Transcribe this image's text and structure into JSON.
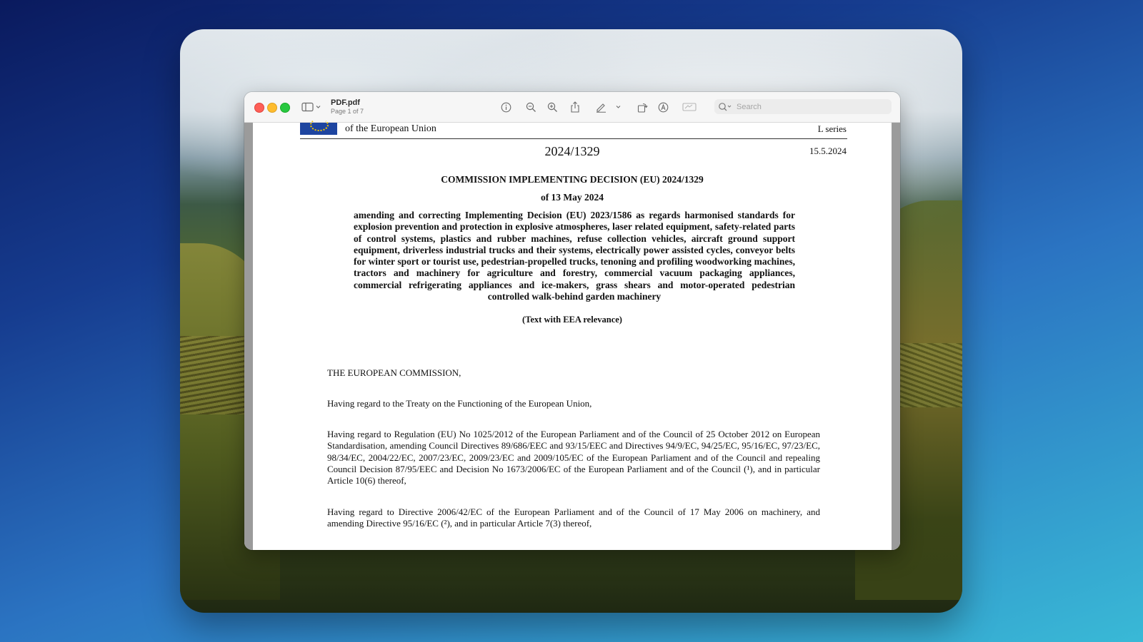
{
  "window": {
    "file_name": "PDF.pdf",
    "page_info": "Page 1 of 7"
  },
  "toolbar": {
    "icons": [
      "sidebar-icon",
      "chevron-down-icon",
      "info-icon",
      "zoom-out-icon",
      "zoom-in-icon",
      "share-icon",
      "markup-pen-icon",
      "chevron-down-icon",
      "rotate-icon",
      "annotate-icon",
      "form-icon",
      "search-icon"
    ]
  },
  "search": {
    "placeholder": "Search",
    "value": ""
  },
  "document": {
    "header": {
      "journal": "of the European Union",
      "series": "L series",
      "number": "2024/1329",
      "date": "15.5.2024"
    },
    "title": "COMMISSION IMPLEMENTING DECISION (EU) 2024/1329",
    "subtitle": "of 13 May 2024",
    "summary": "amending and correcting Implementing Decision (EU) 2023/1586 as regards harmonised standards for explosion prevention and protection in explosive atmospheres, laser related equipment, safety-related parts of control systems, plastics and rubber machines, refuse collection vehicles, aircraft ground support equipment, driverless industrial trucks and their systems, electrically power assisted cycles, conveyor belts for winter sport or tourist use, pedestrian-propelled trucks, tenoning and profiling woodworking machines, tractors and machinery for agriculture and forestry, commercial vacuum packaging appliances, commercial refrigerating appliances and ice-makers, grass shears and motor-operated pedestrian controlled walk-behind garden machinery",
    "eea": "(Text with EEA relevance)",
    "paragraphs": [
      "THE EUROPEAN COMMISSION,",
      "Having regard to the Treaty on the Functioning of the European Union,",
      "Having regard to Regulation (EU) No 1025/2012 of the European Parliament and of the Council of 25 October 2012 on European Standardisation, amending Council Directives 89/686/EEC and 93/15/EEC and Directives 94/9/EC, 94/25/EC, 95/16/EC, 97/23/EC, 98/34/EC, 2004/22/EC, 2007/23/EC, 2009/23/EC and 2009/105/EC of the European Parliament and of the Council and repealing Council Decision 87/95/EEC and Decision No 1673/2006/EC of the European Parliament and of the Council (¹), and in particular Article 10(6) thereof,",
      "Having regard to Directive 2006/42/EC of the European Parliament and of the Council of 17 May 2006 on machinery, and amending Directive 95/16/EC (²), and in particular Article 7(3) thereof,"
    ]
  }
}
